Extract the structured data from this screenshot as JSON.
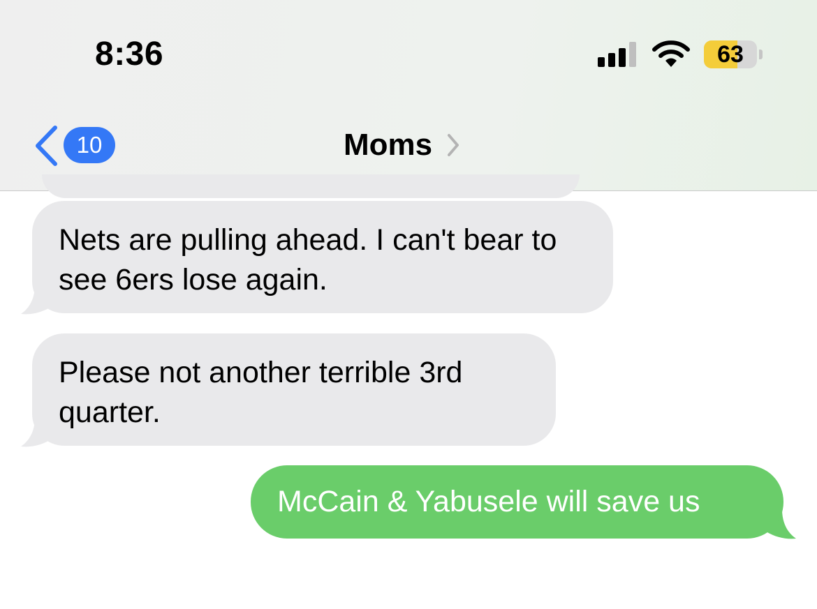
{
  "status_bar": {
    "time": "8:36",
    "battery_percent": "63",
    "battery_level": 0.63,
    "signal_bars_active": 3,
    "signal_bars_total": 4
  },
  "nav": {
    "back_badge_count": "10",
    "contact_name": "Moms",
    "back_icon": "chevron-left-icon",
    "details_icon": "chevron-right-icon"
  },
  "messages": [
    {
      "direction": "received",
      "text": "Nets are pulling ahead. I can't bear to see 6ers lose again."
    },
    {
      "direction": "received",
      "text": "Please not another terrible 3rd quarter."
    },
    {
      "direction": "sent",
      "text": "McCain & Yabusele will save us"
    }
  ],
  "colors": {
    "accent_blue": "#3478f6",
    "sent_bubble": "#6acd6a",
    "received_bubble": "#e9e9eb",
    "battery_yellow": "#f4cd3a"
  }
}
